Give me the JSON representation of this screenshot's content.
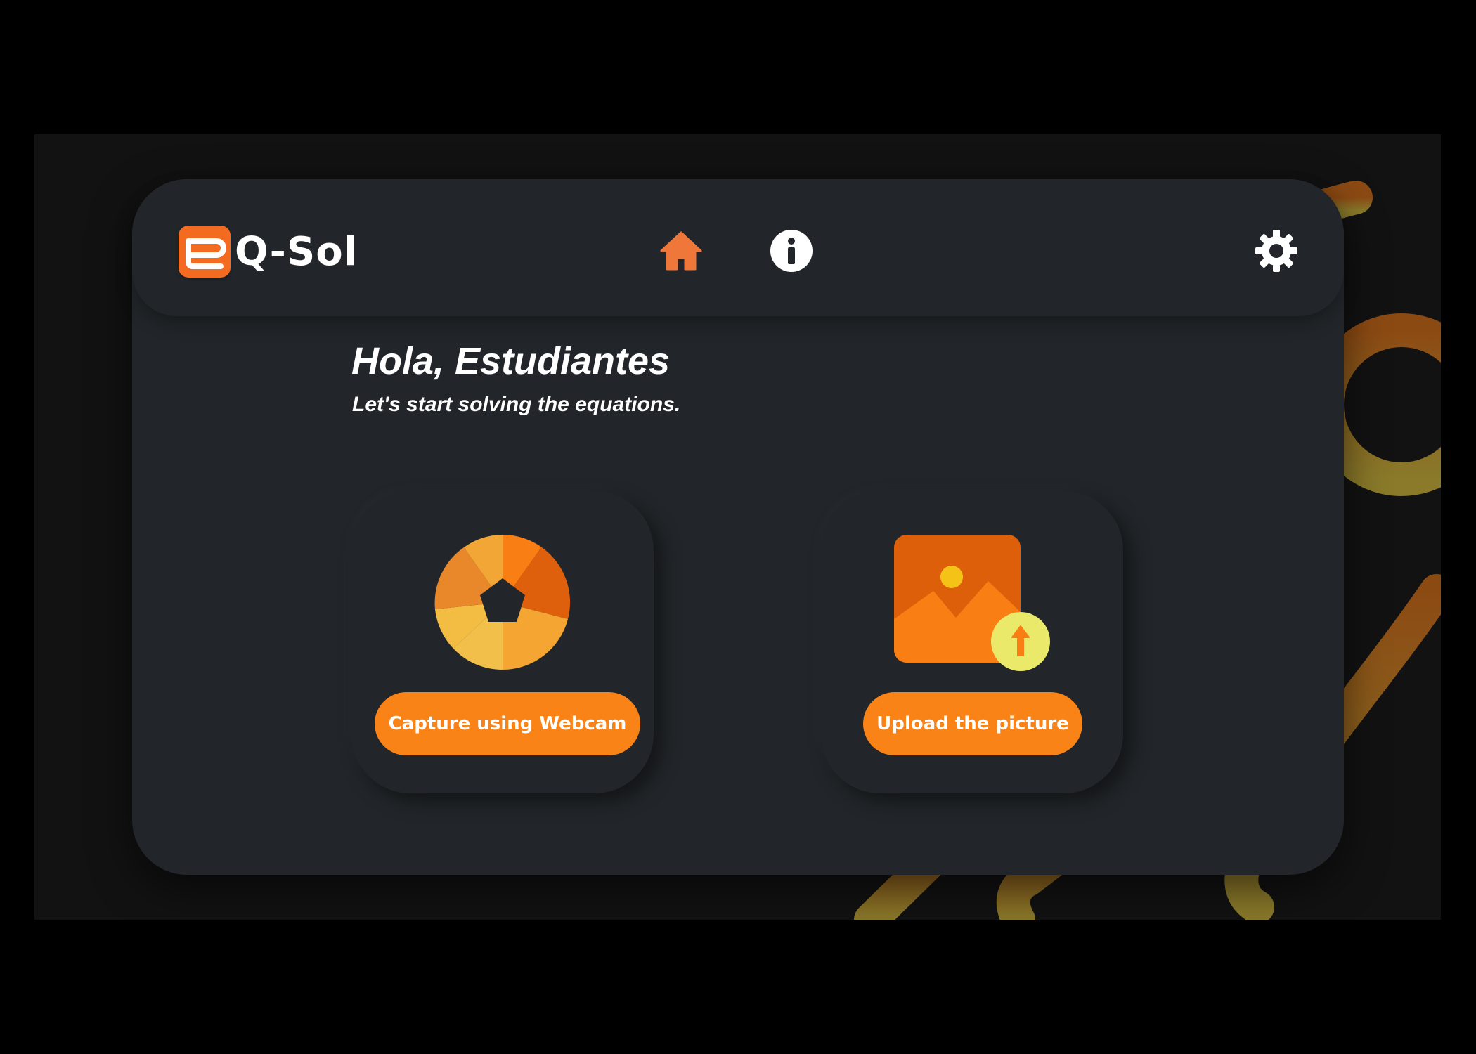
{
  "header": {
    "app_name": "Q-Sol",
    "logo_icon": "eq-logo-icon",
    "nav": [
      {
        "icon": "home-icon",
        "active": true,
        "color": "#f0773a"
      },
      {
        "icon": "info-icon",
        "active": false,
        "color": "#ffffff"
      }
    ],
    "settings_icon": "gear-icon"
  },
  "main": {
    "greeting": "Hola, Estudiantes",
    "subtitle": "Let's start solving the equations.",
    "cards": {
      "webcam": {
        "icon": "camera-shutter-icon",
        "button_label": "Capture using Webcam"
      },
      "upload": {
        "icon": "image-upload-icon",
        "button_label": "Upload the picture"
      }
    }
  },
  "colors": {
    "accent": "#fa8318",
    "logo": "#f36a21",
    "panel": "#22262a",
    "background": "#121212"
  }
}
